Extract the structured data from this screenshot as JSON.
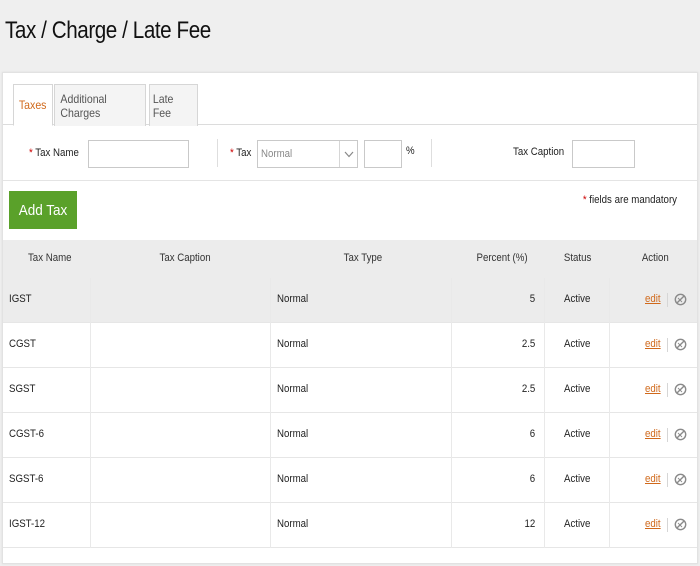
{
  "page": {
    "title": "Tax / Charge / Late Fee"
  },
  "tabs": [
    {
      "label": "Taxes",
      "active": true
    },
    {
      "label": "Additional Charges",
      "active": false
    },
    {
      "label": "Late Fee",
      "active": false
    }
  ],
  "form": {
    "tax_name_label": "Tax Name",
    "tax_name_value": "",
    "tax_label": "Tax",
    "tax_type_selected": "Normal",
    "percent_value": "",
    "percent_symbol": "%",
    "caption_label": "Tax Caption",
    "caption_value": "",
    "required_mark": "*"
  },
  "add_button_label": "Add Tax",
  "mandatory_note": "fields are mandatory",
  "table": {
    "headers": [
      "Tax Name",
      "Tax Caption",
      "Tax Type",
      "Percent (%)",
      "Status",
      "Action"
    ],
    "edit_label": "edit",
    "rows": [
      {
        "name": "IGST",
        "caption": "",
        "type": "Normal",
        "percent": "5",
        "status": "Active"
      },
      {
        "name": "CGST",
        "caption": "",
        "type": "Normal",
        "percent": "2.5",
        "status": "Active"
      },
      {
        "name": "SGST",
        "caption": "",
        "type": "Normal",
        "percent": "2.5",
        "status": "Active"
      },
      {
        "name": "CGST-6",
        "caption": "",
        "type": "Normal",
        "percent": "6",
        "status": "Active"
      },
      {
        "name": "SGST-6",
        "caption": "",
        "type": "Normal",
        "percent": "6",
        "status": "Active"
      },
      {
        "name": "IGST-12",
        "caption": "",
        "type": "Normal",
        "percent": "12",
        "status": "Active"
      }
    ]
  },
  "icons": {
    "select_arrow": "chevron-down-icon",
    "delete": "delete-icon"
  },
  "colors": {
    "accent": "#d0691b",
    "button": "#5aa12a",
    "required": "#cc0000"
  }
}
